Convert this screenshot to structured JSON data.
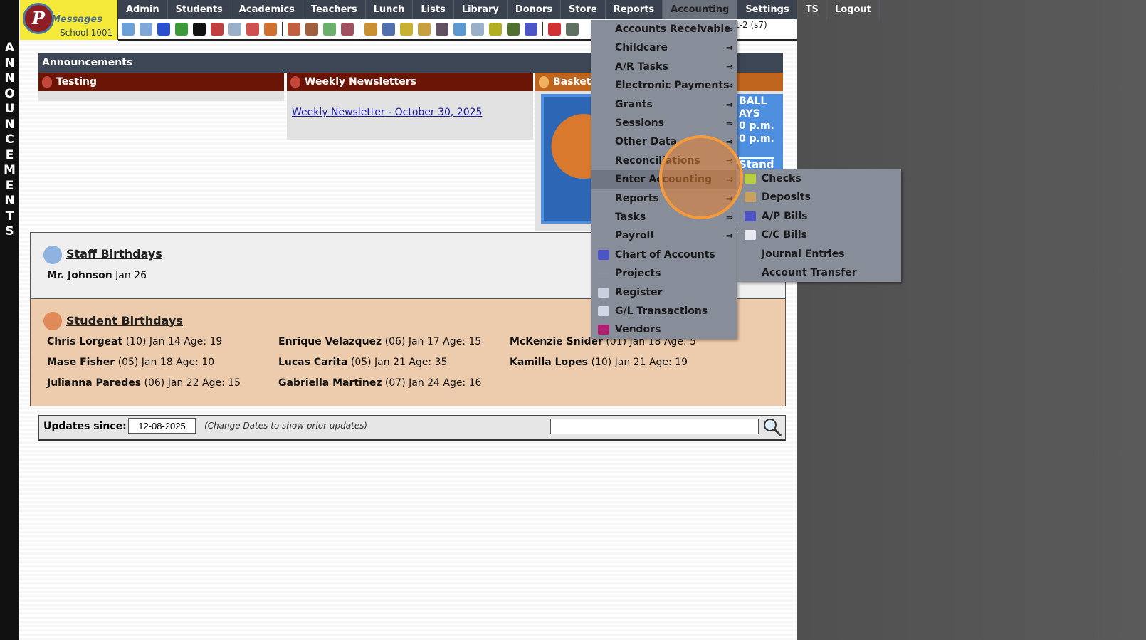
{
  "sidebar_letters": [
    "A",
    "N",
    "N",
    "O",
    "U",
    "N",
    "C",
    "E",
    "M",
    "E",
    "N",
    "T",
    "S"
  ],
  "logo": {
    "brand": "Messages",
    "school": "School 1001"
  },
  "nav": [
    "Admin",
    "Students",
    "Academics",
    "Teachers",
    "Lunch",
    "Lists",
    "Library",
    "Donors",
    "Store",
    "Reports",
    "Accounting",
    "Settings",
    "TS",
    "Logout"
  ],
  "user_info": "t-2 (s7)",
  "announcements": {
    "title": "Announcements",
    "columns": [
      {
        "title": "Testing"
      },
      {
        "title": "Weekly Newsletters",
        "link": "Weekly Newsletter - October 30, 2025"
      },
      {
        "title": "Basketball",
        "poster": [
          "BALL",
          "AYS",
          "0 p.m.",
          "0 p.m.",
          "Stand"
        ]
      }
    ]
  },
  "staff_birthdays": {
    "title": "Staff Birthdays",
    "entries": [
      {
        "name": "Mr. Johnson",
        "info": "Jan 26"
      }
    ]
  },
  "student_birthdays": {
    "title": "Student Birthdays",
    "entries": [
      {
        "name": "Chris Lorgeat",
        "info": "(10) Jan 14 Age: 19"
      },
      {
        "name": "Enrique Velazquez",
        "info": "(06) Jan 17 Age: 15"
      },
      {
        "name": "McKenzie Snider",
        "info": "(01) Jan 18 Age: 5"
      },
      {
        "name": "Mase Fisher",
        "info": "(05) Jan 18 Age: 10"
      },
      {
        "name": "Lucas Carita",
        "info": "(05) Jan 21 Age: 35"
      },
      {
        "name": "Kamilla Lopes",
        "info": "(10) Jan 21 Age: 19"
      },
      {
        "name": "Julianna Paredes",
        "info": "(06) Jan 22 Age: 15"
      },
      {
        "name": "Gabriella Martinez",
        "info": "(07) Jan 24 Age: 16"
      }
    ]
  },
  "updates": {
    "label": "Updates since:",
    "date": "12-08-2025",
    "hint": "(Change Dates to show prior updates)",
    "search_value": ""
  },
  "accounting_menu": [
    {
      "label": "Accounts Receivable",
      "arrow": "⇒"
    },
    {
      "label": "Childcare",
      "arrow": "⇒"
    },
    {
      "label": "A/R Tasks",
      "arrow": "⇒"
    },
    {
      "label": "Electronic Payments",
      "arrow": "⇒"
    },
    {
      "label": "Grants",
      "arrow": "⇒"
    },
    {
      "label": "Sessions",
      "arrow": "⇒"
    },
    {
      "label": "Other Data",
      "arrow": "⇒"
    },
    {
      "label": "Reconciliations",
      "arrow": "⇒"
    },
    {
      "label": "Enter Accounting",
      "arrow": "⇒"
    },
    {
      "label": "Reports",
      "arrow": "⇒"
    },
    {
      "label": "Tasks",
      "arrow": "⇒"
    },
    {
      "label": "Payroll",
      "arrow": "⇒"
    },
    {
      "label": "Chart of Accounts"
    },
    {
      "label": "Projects"
    },
    {
      "label": "Register"
    },
    {
      "label": "G/L Transactions"
    },
    {
      "label": "Vendors"
    }
  ],
  "enter_accounting_submenu": [
    "Checks",
    "Deposits",
    "A/P Bills",
    "C/C Bills",
    "Journal Entries",
    "Account Transfer"
  ],
  "colors": {
    "nav": "#3b424f",
    "testing": "#6a1505",
    "basketball": "#c0651d",
    "menu": "#878d99",
    "highlight": "#f39a3c"
  }
}
